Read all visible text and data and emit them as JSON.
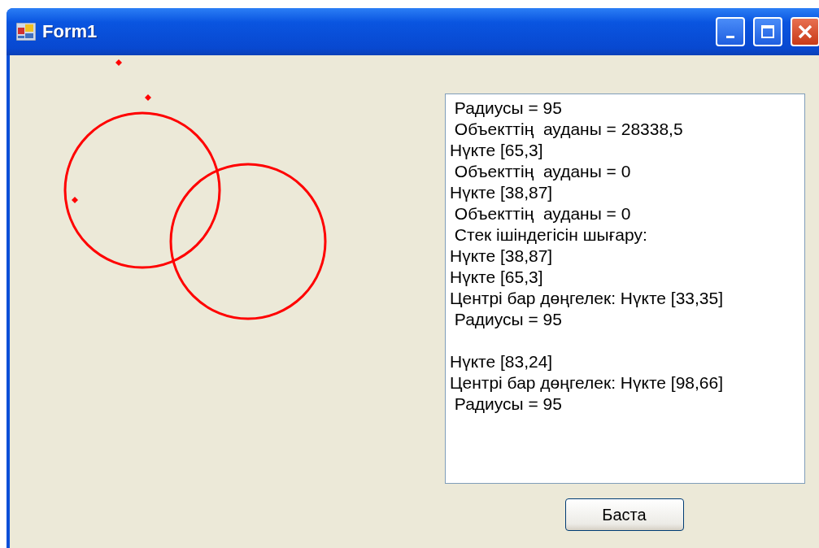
{
  "window": {
    "title": "Form1"
  },
  "output": {
    "blocks": [
      {
        "lines": [
          " Радиусы = 95",
          " Объекттің  ауданы = 28338,5",
          "Нүкте [65,3]",
          " Объекттің  ауданы = 0",
          "Нүкте [38,87]",
          " Объекттің  ауданы = 0",
          " Стек ішіндегісін шығару:",
          "Нүкте [38,87]",
          "Нүкте [65,3]",
          "Центрі бар дөңгелек: Нүкте [33,35]",
          " Радиусы = 95"
        ]
      },
      {
        "lines": [
          "Нүкте [83,24]",
          "Центрі бар дөңгелек: Нүкте [98,66]",
          " Радиусы = 95"
        ]
      }
    ]
  },
  "buttons": [
    {
      "label": "Баста"
    }
  ]
}
